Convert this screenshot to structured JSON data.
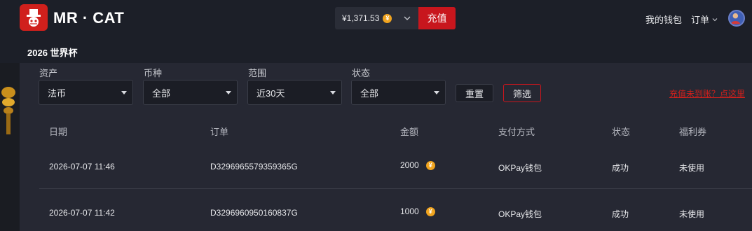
{
  "header": {
    "brand": "MR · CAT",
    "balance": "¥1,371.53",
    "balance_coin": "¥",
    "recharge_label": "充值",
    "wallet_label": "我的钱包",
    "orders_label": "订单"
  },
  "subnav": {
    "item": "2026 世界杯"
  },
  "filters": {
    "asset": {
      "label": "资产",
      "value": "法币"
    },
    "currency": {
      "label": "币种",
      "value": "全部"
    },
    "range": {
      "label": "范围",
      "value": "近30天"
    },
    "status": {
      "label": "状态",
      "value": "全部"
    },
    "reset_label": "重置",
    "filter_label": "筛选",
    "help_link": "充值未到账？点这里"
  },
  "table": {
    "headers": [
      "日期",
      "订单",
      "金额",
      "支付方式",
      "状态",
      "福利券"
    ],
    "rows": [
      {
        "date": "2026-07-07 11:46",
        "order": "D3296965579359365G",
        "amount": "2000",
        "coin": "¥",
        "method": "OKPay钱包",
        "status": "成功",
        "coupon": "未使用"
      },
      {
        "date": "2026-07-07 11:42",
        "order": "D3296960950160837G",
        "amount": "1000",
        "coin": "¥",
        "method": "OKPay钱包",
        "status": "成功",
        "coupon": "未使用"
      }
    ]
  },
  "colors": {
    "accent": "#c8161d",
    "coin": "#f0a41f",
    "background": "#1c1f28",
    "panel": "#262833"
  }
}
